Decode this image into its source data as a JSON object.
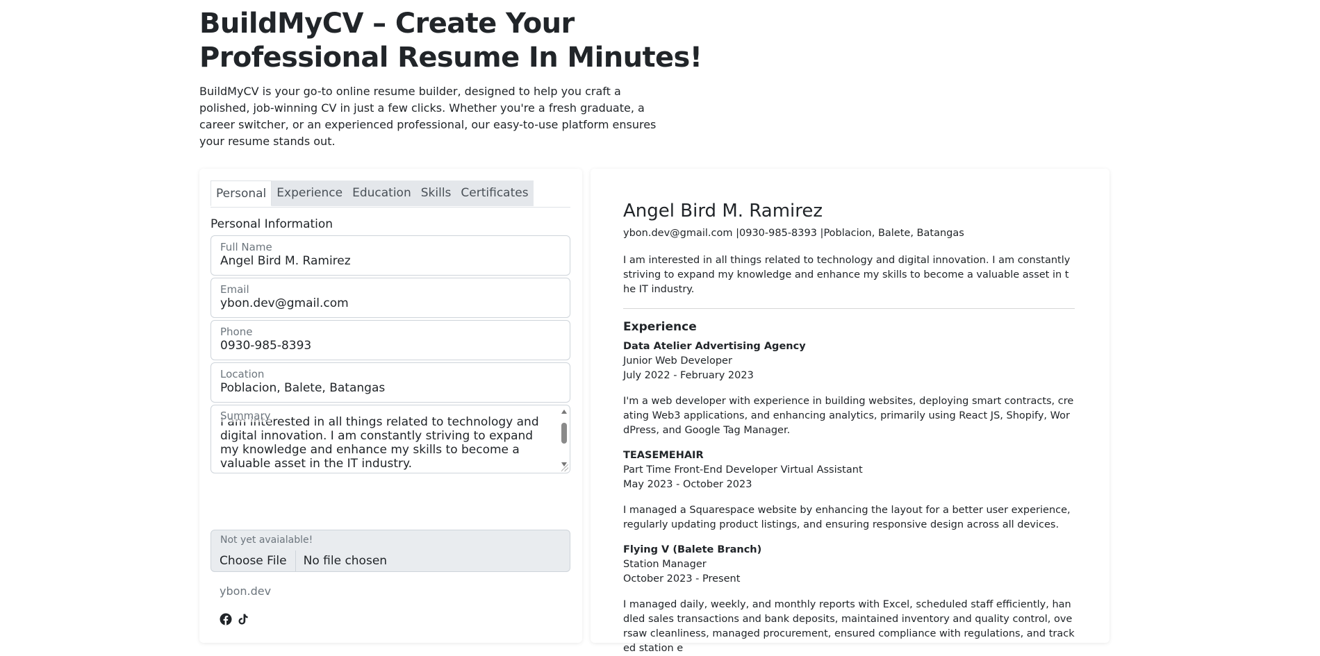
{
  "hero": {
    "title": "BuildMyCV – Create Your Professional Resume In Minutes!",
    "description": "BuildMyCV is your go-to online resume builder, designed to help you craft a polished, job-winning CV in just a few clicks. Whether you're a fresh graduate, a career switcher, or an experienced professional, our easy-to-use platform ensures your resume stands out."
  },
  "tabs": [
    "Personal",
    "Experience",
    "Education",
    "Skills",
    "Certificates"
  ],
  "active_tab": "Personal",
  "form": {
    "section_title": "Personal Information",
    "full_name": {
      "label": "Full Name",
      "value": "Angel Bird M. Ramirez"
    },
    "email": {
      "label": "Email",
      "value": "ybon.dev@gmail.com"
    },
    "phone": {
      "label": "Phone",
      "value": "0930-985-8393"
    },
    "location": {
      "label": "Location",
      "value": "Poblacion, Balete, Batangas"
    },
    "summary": {
      "label": "Summary",
      "value": "I am interested in all things related to technology and digital innovation. I am constantly striving to expand my knowledge and enhance my skills to become a valuable asset in the IT industry."
    },
    "photo": {
      "label": "Not yet avaialable!",
      "button": "Choose File",
      "status": "No file chosen"
    },
    "footer_link": "ybon.dev",
    "social_icons": [
      "facebook-icon",
      "tiktok-icon"
    ]
  },
  "preview": {
    "name": "Angel Bird M. Ramirez",
    "contact": "ybon.dev@gmail.com |0930-985-8393 |Poblacion, Balete, Batangas",
    "summary": "I am interested in all things related to technology and digital innovation. I am constantly striving to expand my knowledge and enhance my skills to become a valuable asset in the IT industry.",
    "experience_title": "Experience",
    "experience": [
      {
        "company": "Data Atelier Advertising Agency",
        "role": "Junior Web Developer",
        "dates": "July 2022 - February 2023",
        "description": "I'm a web developer with experience in building websites, deploying smart contracts, creating Web3 applications, and enhancing analytics, primarily using React JS, Shopify, WordPress, and Google Tag Manager."
      },
      {
        "company": "TEASEMEHAIR",
        "role": "Part Time Front-End Developer Virtual Assistant",
        "dates": "May 2023 - October 2023",
        "description": "I managed a Squarespace website by enhancing the layout for a better user experience, regularly updating product listings, and ensuring responsive design across all devices."
      },
      {
        "company": "Flying V (Balete Branch)",
        "role": "Station Manager",
        "dates": "October 2023 - Present",
        "description": "I managed daily, weekly, and monthly reports with Excel, scheduled staff efficiently, handled sales transactions and bank deposits, maintained inventory and quality control, oversaw cleanliness, managed procurement, ensured compliance with regulations, and tracked station e"
      }
    ]
  }
}
